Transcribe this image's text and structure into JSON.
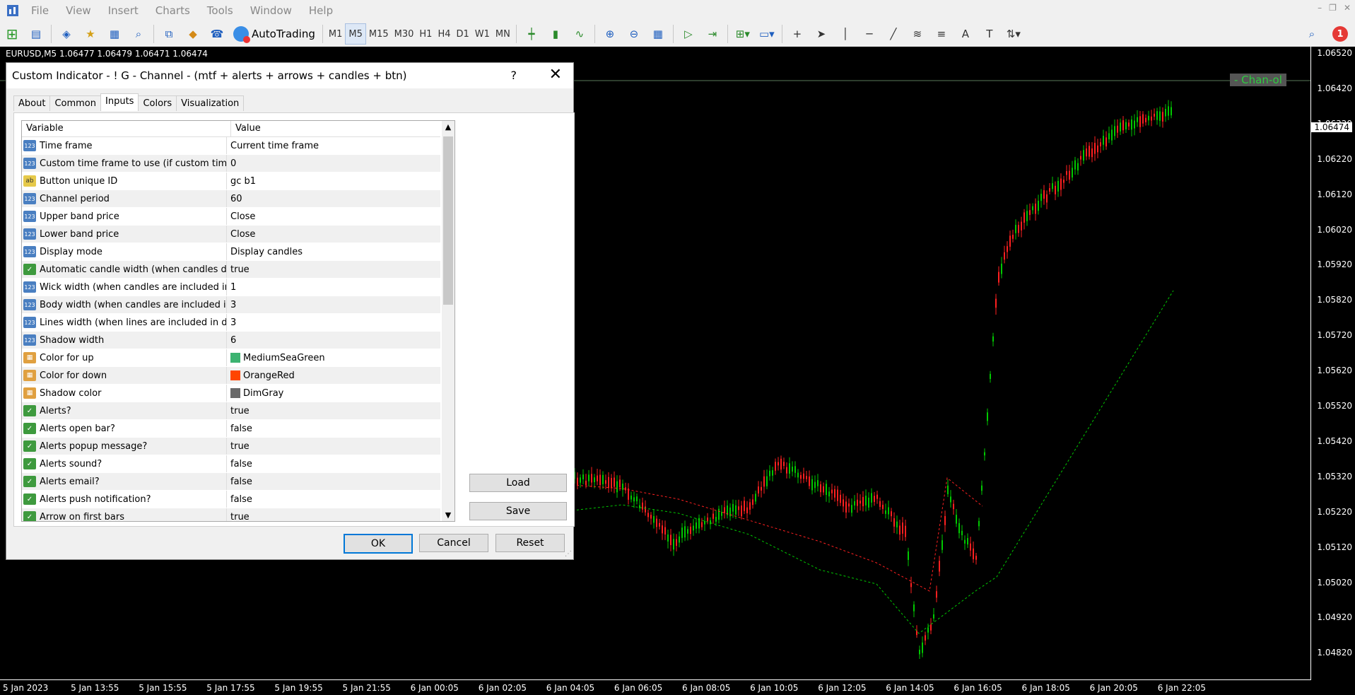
{
  "menubar": {
    "items": [
      "File",
      "View",
      "Insert",
      "Charts",
      "Tools",
      "Window",
      "Help"
    ]
  },
  "toolbar": {
    "autotrading_label": "AutoTrading",
    "timeframes": [
      "M1",
      "M5",
      "M15",
      "M30",
      "H1",
      "H4",
      "D1",
      "W1",
      "MN"
    ],
    "active_timeframe": "M5",
    "notification_count": "1"
  },
  "chart": {
    "title": "EURUSD,M5  1.06477 1.06479 1.06471 1.06474",
    "current_price": "1.06474",
    "channel_label": "- Chan-ol",
    "price_labels": [
      "1.06520",
      "1.06420",
      "1.06320",
      "1.06220",
      "1.06120",
      "1.06020",
      "1.05920",
      "1.05820",
      "1.05720",
      "1.05620",
      "1.05520",
      "1.05420",
      "1.05320",
      "1.05220",
      "1.05120",
      "1.05020",
      "1.04920",
      "1.04820"
    ],
    "time_labels": [
      "5 Jan 2023",
      "5 Jan 13:55",
      "5 Jan 15:55",
      "5 Jan 17:55",
      "5 Jan 19:55",
      "5 Jan 21:55",
      "6 Jan 00:05",
      "6 Jan 02:05",
      "6 Jan 04:05",
      "6 Jan 06:05",
      "6 Jan 08:05",
      "6 Jan 10:05",
      "6 Jan 12:05",
      "6 Jan 14:05",
      "6 Jan 16:05",
      "6 Jan 18:05",
      "6 Jan 20:05",
      "6 Jan 22:05"
    ],
    "colors": {
      "up": "#00c800",
      "down": "#ff2020",
      "background": "#000000"
    }
  },
  "dialog": {
    "title": "Custom Indicator - ! G - Channel - (mtf + alerts + arrows + candles + btn)",
    "help": "?",
    "tabs": [
      "About",
      "Common",
      "Inputs",
      "Colors",
      "Visualization"
    ],
    "active_tab": "Inputs",
    "columns": {
      "variable": "Variable",
      "value": "Value"
    },
    "rows": [
      {
        "icon": "123",
        "name": "Time frame",
        "value": "Current time frame"
      },
      {
        "icon": "123",
        "name": "Custom time frame to use (if custom time fra...",
        "value": "0"
      },
      {
        "icon": "ab",
        "name": "Button unique ID",
        "value": "gc b1"
      },
      {
        "icon": "123",
        "name": "Channel period",
        "value": "60"
      },
      {
        "icon": "123",
        "name": "Upper band price",
        "value": "Close"
      },
      {
        "icon": "123",
        "name": "Lower band price",
        "value": "Close"
      },
      {
        "icon": "123",
        "name": "Display mode",
        "value": "Display candles"
      },
      {
        "icon": "bool",
        "name": "Automatic candle width (when candles disp...",
        "value": "true"
      },
      {
        "icon": "123",
        "name": "Wick width (when candles are included in d...",
        "value": "1"
      },
      {
        "icon": "123",
        "name": "Body width (when candles are included in ...",
        "value": "3"
      },
      {
        "icon": "123",
        "name": "Lines width (when lines are included in disp...",
        "value": "3"
      },
      {
        "icon": "123",
        "name": "Shadow width",
        "value": "6"
      },
      {
        "icon": "color",
        "name": "Color for up",
        "value": "MediumSeaGreen",
        "swatch": "#3cb371"
      },
      {
        "icon": "color",
        "name": "Color for down",
        "value": "OrangeRed",
        "swatch": "#ff4500"
      },
      {
        "icon": "color",
        "name": "Shadow color",
        "value": "DimGray",
        "swatch": "#696969"
      },
      {
        "icon": "bool",
        "name": "Alerts?",
        "value": "true"
      },
      {
        "icon": "bool",
        "name": "Alerts open bar?",
        "value": "false"
      },
      {
        "icon": "bool",
        "name": "Alerts popup message?",
        "value": "true"
      },
      {
        "icon": "bool",
        "name": "Alerts sound?",
        "value": "false"
      },
      {
        "icon": "bool",
        "name": "Alerts email?",
        "value": "false"
      },
      {
        "icon": "bool",
        "name": "Alerts push notification?",
        "value": "false"
      },
      {
        "icon": "bool",
        "name": "Arrow on first bars",
        "value": "true"
      }
    ],
    "buttons": {
      "load": "Load",
      "save": "Save",
      "ok": "OK",
      "cancel": "Cancel",
      "reset": "Reset"
    }
  }
}
